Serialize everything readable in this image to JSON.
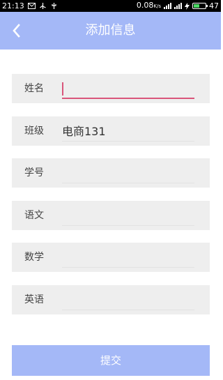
{
  "status_bar": {
    "time": "21:13",
    "net_speed": "0.08",
    "net_unit": "K/s",
    "battery": "47",
    "icons": [
      "mail-icon",
      "usb-icon",
      "usb-debug-icon",
      "signal-icon",
      "signal-icon",
      "charging-icon",
      "battery-icon"
    ]
  },
  "header": {
    "title": "添加信息",
    "back_icon": "chevron-left-icon"
  },
  "form": {
    "fields": [
      {
        "label": "姓名",
        "value": ""
      },
      {
        "label": "班级",
        "value": "电商131"
      },
      {
        "label": "学号",
        "value": ""
      },
      {
        "label": "语文",
        "value": ""
      },
      {
        "label": "数学",
        "value": ""
      },
      {
        "label": "英语",
        "value": ""
      }
    ],
    "submit_label": "提交"
  },
  "colors": {
    "accent": "#a4b8f7",
    "field_bg": "#eeeeee",
    "focus_underline": "#d9557a"
  }
}
